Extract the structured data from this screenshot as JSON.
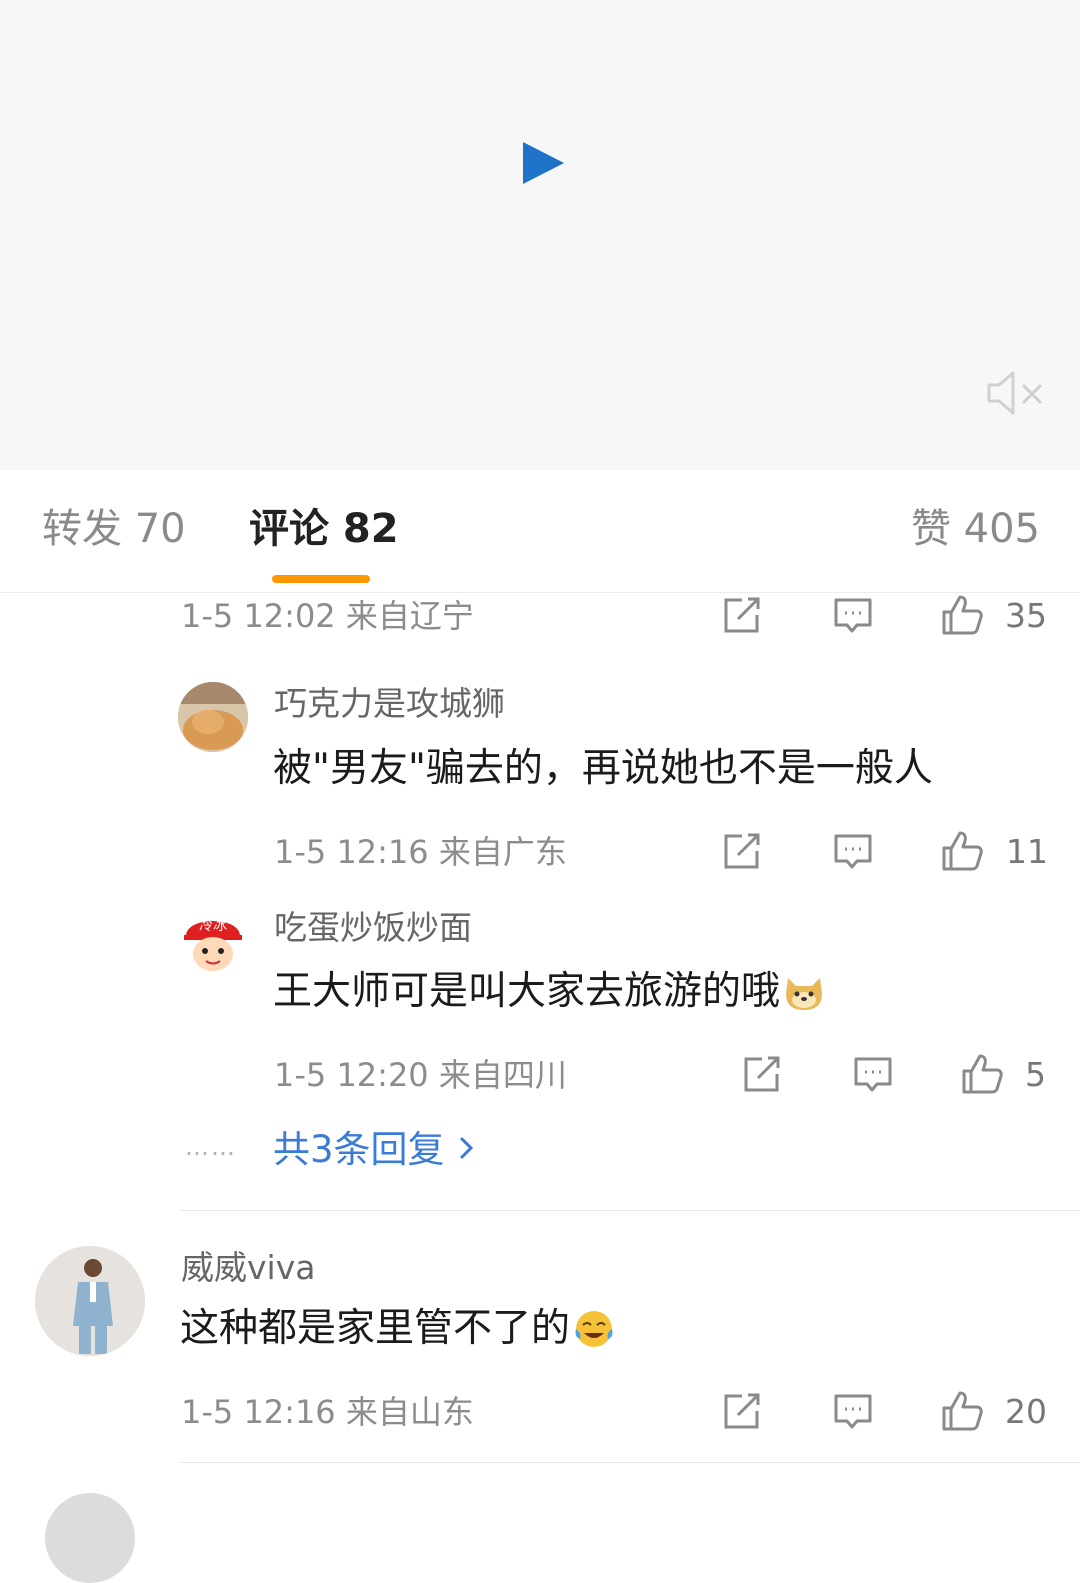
{
  "video": {
    "play_icon": "play-icon",
    "mute_icon": "mute-icon",
    "accent_color": "#1e72c7"
  },
  "tabs": {
    "forward": "转发 70",
    "comments": "评论 82",
    "likes": "赞 405",
    "active_color": "#ff9800"
  },
  "top_comment_meta": {
    "time_location": "1-5 12:02 来自辽宁",
    "likes": "35"
  },
  "replies": [
    {
      "username": "巧克力是攻城狮",
      "text": "被\"男友\"骗去的，再说她也不是一般人",
      "time_location": "1-5 12:16 来自广东",
      "likes": "11"
    },
    {
      "username": "吃蛋炒饭炒面",
      "text": "王大师可是叫大家去旅游的哦",
      "emoji": "doge-emoji",
      "time_location": "1-5 12:20 来自四川",
      "likes": "5"
    }
  ],
  "more_replies": {
    "label": "共3条回复",
    "dots": "……"
  },
  "comment2": {
    "username": "威威viva",
    "text": "这种都是家里管不了的",
    "emoji": "laugh-cry-emoji",
    "time_location": "1-5 12:16 来自山东",
    "likes": "20"
  },
  "icons": {
    "share": "share-icon",
    "comment": "comment-icon",
    "like": "thumbs-up-icon"
  }
}
